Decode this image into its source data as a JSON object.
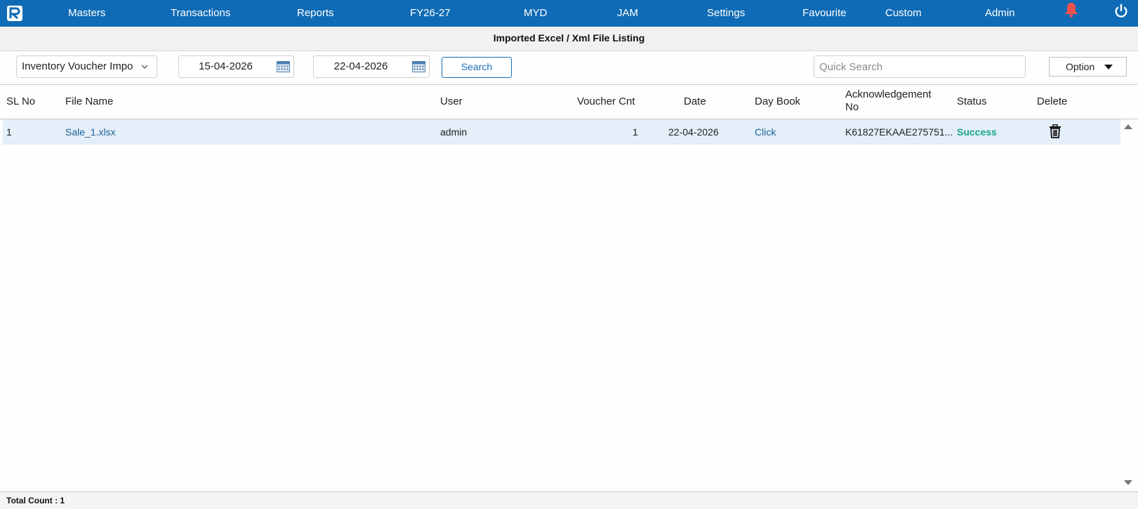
{
  "nav": {
    "items": [
      "Masters",
      "Transactions",
      "Reports",
      "FY26-27",
      "MYD",
      "JAM",
      "Settings",
      "Favourite",
      "Custom",
      "Admin"
    ]
  },
  "colors": {
    "topbar": "#0f6bb5",
    "bell": "#f0514f",
    "row_highlight": "#e4eff9",
    "success": "#1aa884"
  },
  "icons": {
    "logo": "app-logo-icon",
    "bell": "bell-icon",
    "power": "power-icon",
    "calendar": "calendar-icon",
    "trash": "trash-icon"
  },
  "page_title": "Imported Excel / Xml File Listing",
  "toolbar": {
    "import_type": "Inventory Voucher Impo",
    "from_date": "15-04-2026",
    "to_date": "22-04-2026",
    "search_label": "Search",
    "quick_search_placeholder": "Quick Search",
    "option_label": "Option"
  },
  "table": {
    "headers": {
      "sl_no": "SL No",
      "file_name": "File Name",
      "user": "User",
      "voucher_cnt": "Voucher Cnt",
      "date": "Date",
      "day_book": "Day Book",
      "ack_line1": "Acknowledgement",
      "ack_line2": "No",
      "status": "Status",
      "delete": "Delete"
    },
    "rows": [
      {
        "sl_no": "1",
        "file_name": "Sale_1.xlsx",
        "user": "admin",
        "voucher_cnt": "1",
        "date": "22-04-2026",
        "day_book": "Click",
        "ack_no": "K61827EKAAE275751...",
        "status": "Success"
      }
    ]
  },
  "footer": {
    "total_count": "Total Count : 1"
  }
}
